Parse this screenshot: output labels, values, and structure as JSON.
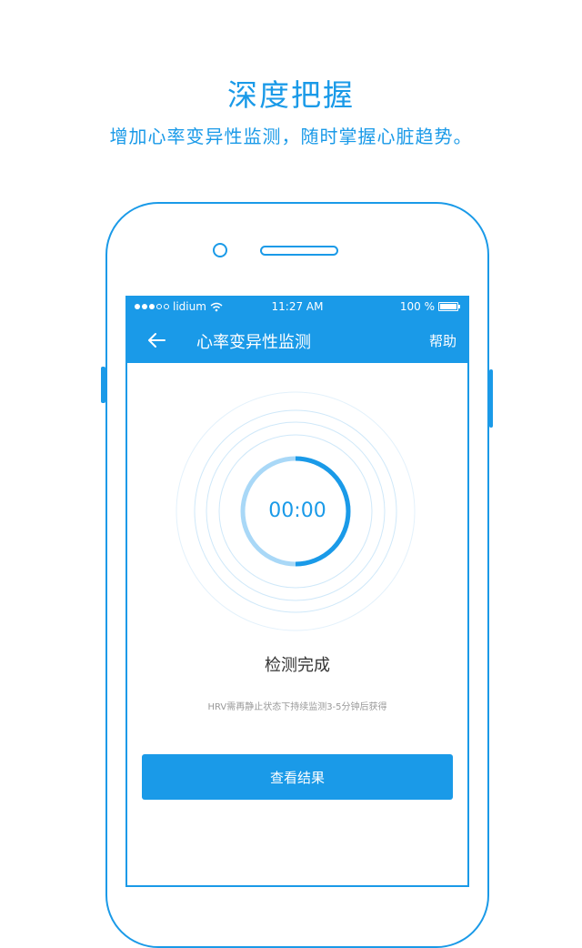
{
  "promo": {
    "headline": "深度把握",
    "subline": "增加心率变异性监测，随时掌握心脏趋势。"
  },
  "status_bar": {
    "carrier": "lidium",
    "time": "11:27 AM",
    "battery_text": "100 %",
    "battery_level": 1.0
  },
  "nav": {
    "title": "心率变异性监测",
    "help": "帮助"
  },
  "monitor": {
    "timer": "00:00",
    "status": "检测完成",
    "hint": "HRV需再静止状态下持续监测3-5分钟后获得",
    "progress": 0.5
  },
  "actions": {
    "view_result": "查看结果"
  },
  "colors": {
    "accent": "#1a9ae8",
    "ring_light": "#a9d8f7",
    "ring_faint": "#cfe8f9"
  },
  "icons": [
    "back-arrow-icon",
    "wifi-icon",
    "battery-icon",
    "signal-dots-icon"
  ]
}
